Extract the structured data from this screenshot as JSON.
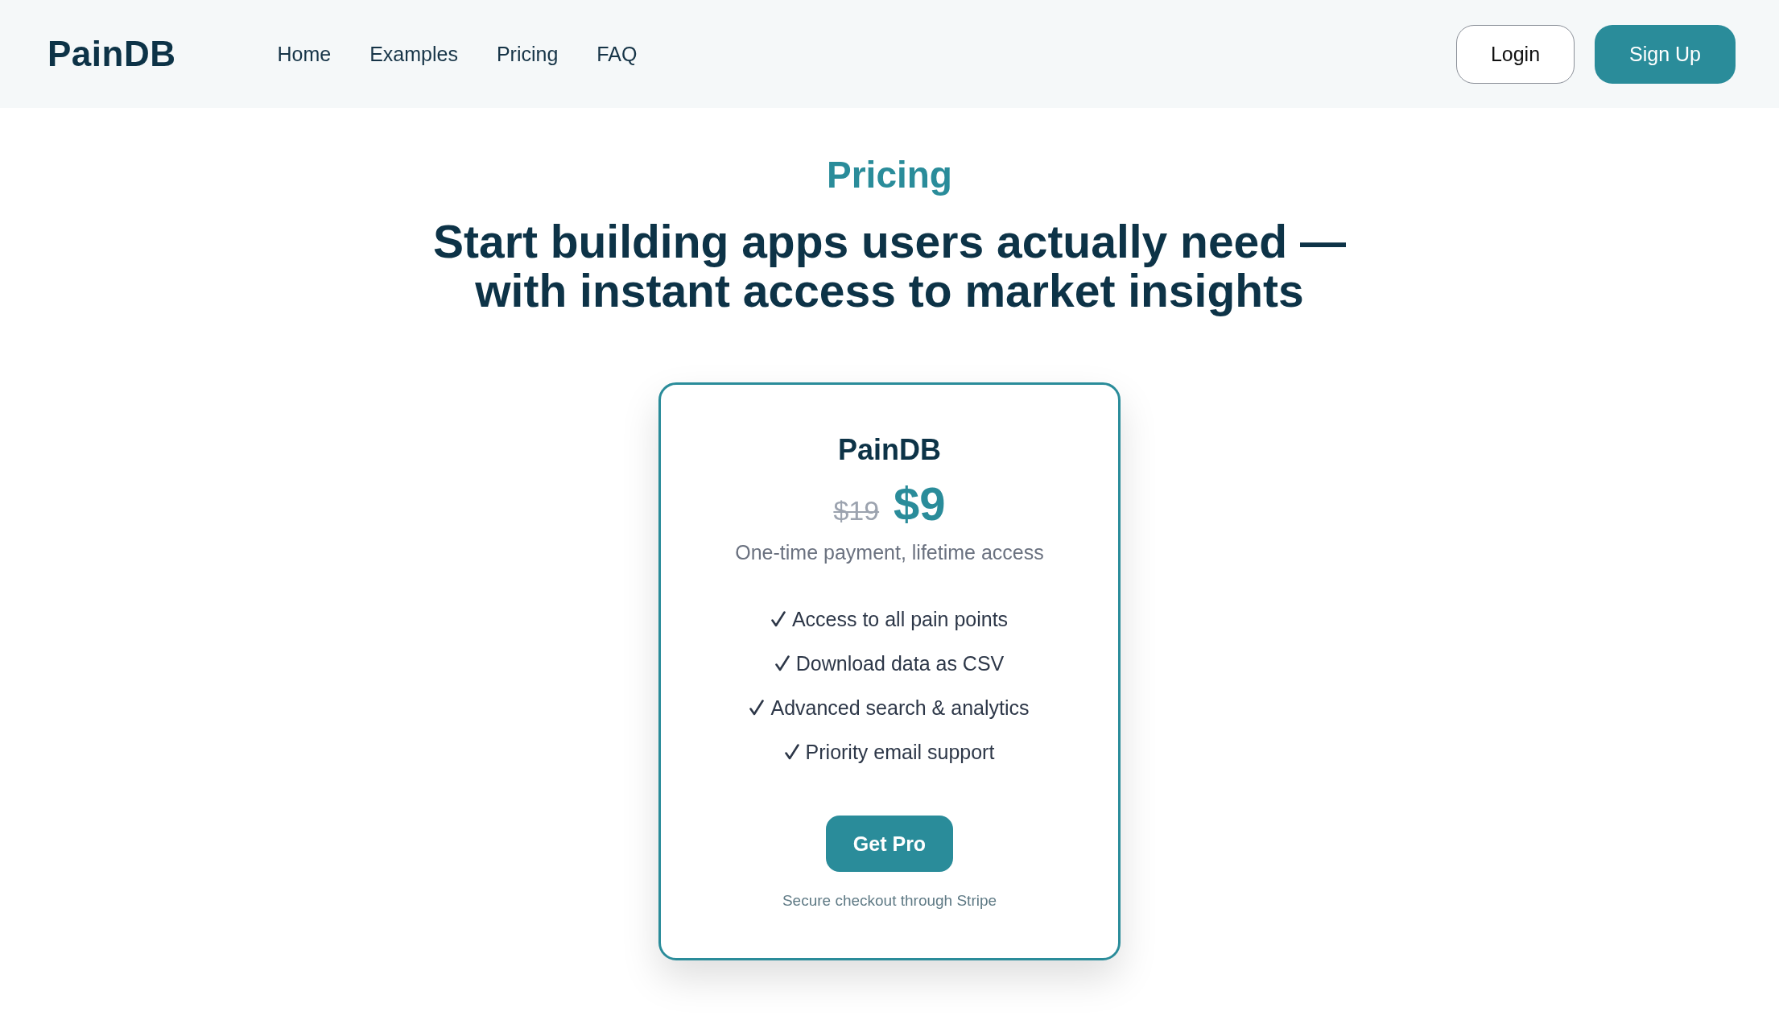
{
  "header": {
    "logo": "PainDB",
    "nav_links": [
      {
        "label": "Home"
      },
      {
        "label": "Examples"
      },
      {
        "label": "Pricing"
      },
      {
        "label": "FAQ"
      }
    ],
    "buttons": [
      {
        "label": "Login",
        "kind": "outline"
      },
      {
        "label": "Sign Up",
        "kind": "primary"
      }
    ]
  },
  "hero": {
    "eyebrow": "Pricing",
    "title": "Start building apps users actually need — with instant access to market insights"
  },
  "plan": {
    "name": "PainDB",
    "original_price": "$19",
    "price": "$9",
    "billing_note": "One-time payment, lifetime access",
    "features": [
      "Access to all pain points",
      "Download data as CSV",
      "Advanced search & analytics",
      "Priority email support"
    ],
    "cta": "Get Pro",
    "footnote": "Secure checkout through Stripe"
  }
}
